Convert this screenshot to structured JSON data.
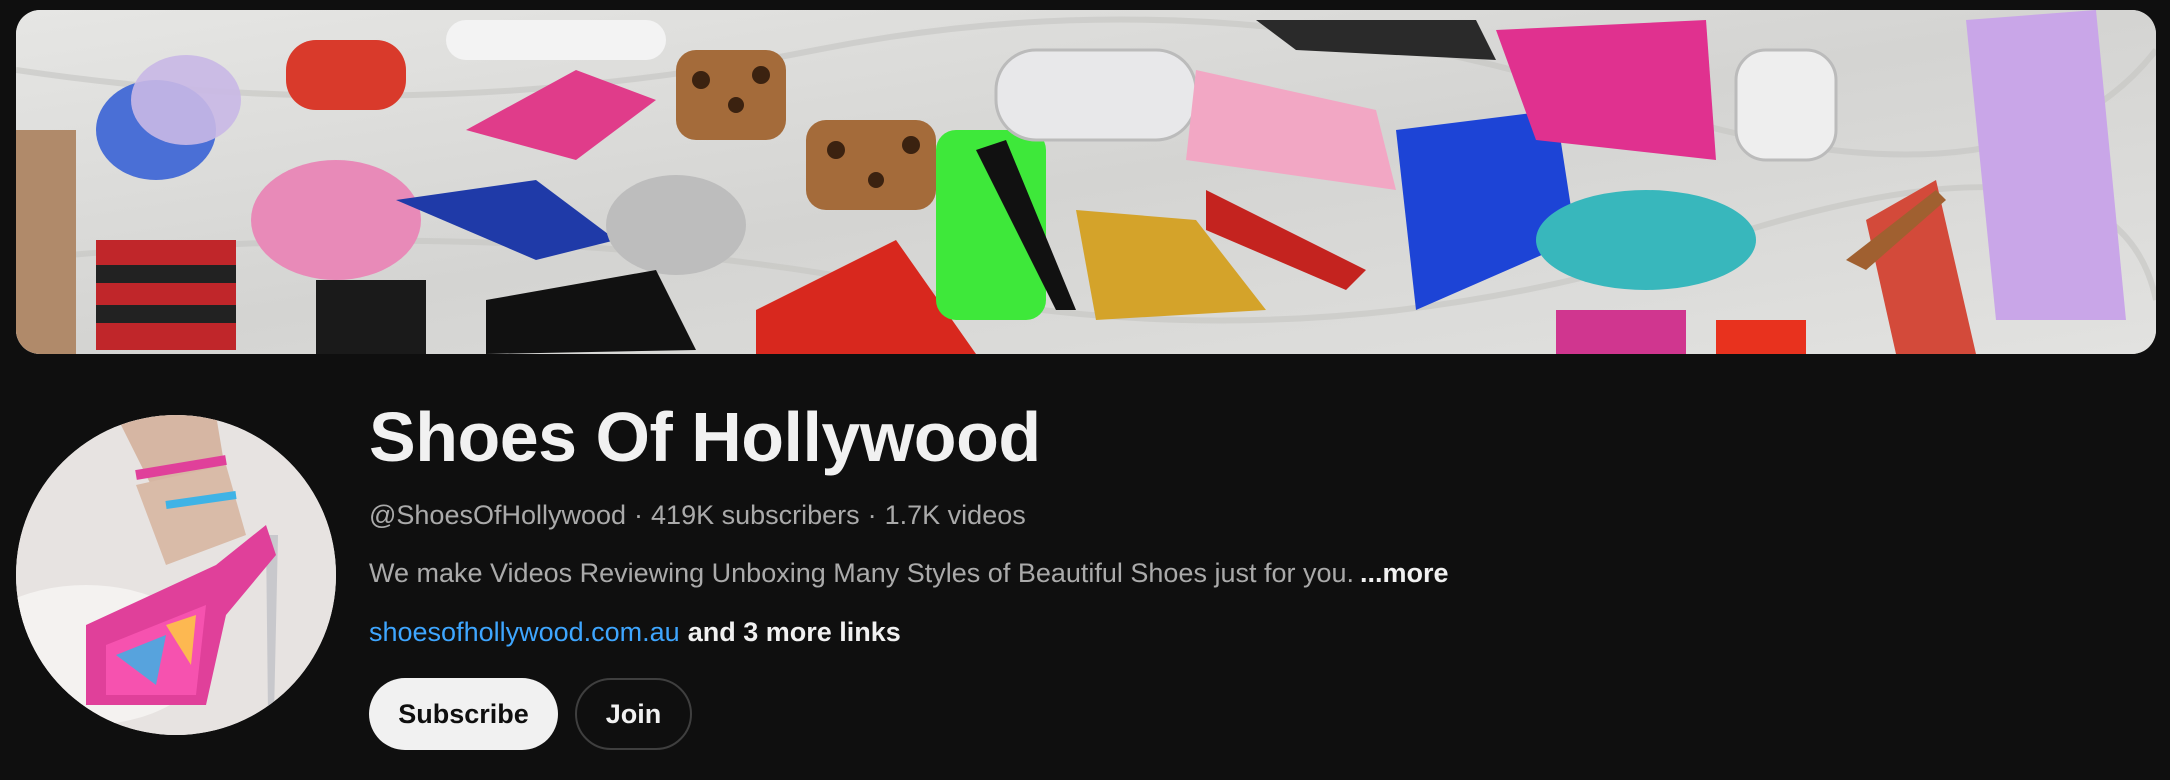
{
  "banner": {
    "description_icon": "shoe-collage-banner"
  },
  "avatar": {
    "icon": "platform-heel-avatar"
  },
  "channel": {
    "title": "Shoes Of Hollywood",
    "handle": "@ShoesOfHollywood",
    "subscribers": "419K subscribers",
    "videos": "1.7K videos",
    "separator": "·",
    "description": "We make Videos Reviewing Unboxing Many Styles of Beautiful Shoes just for you.",
    "more_label": "...more",
    "link_text": "shoesofhollywood.com.au",
    "more_links_label": "and 3 more links"
  },
  "actions": {
    "subscribe_label": "Subscribe",
    "join_label": "Join"
  },
  "colors": {
    "background": "#0f0f0f",
    "text_primary": "#f1f1f1",
    "text_secondary": "#aaaaaa",
    "link": "#3ea6ff",
    "subscribe_bg": "#f1f1f1",
    "join_border": "#3f3f3f"
  }
}
